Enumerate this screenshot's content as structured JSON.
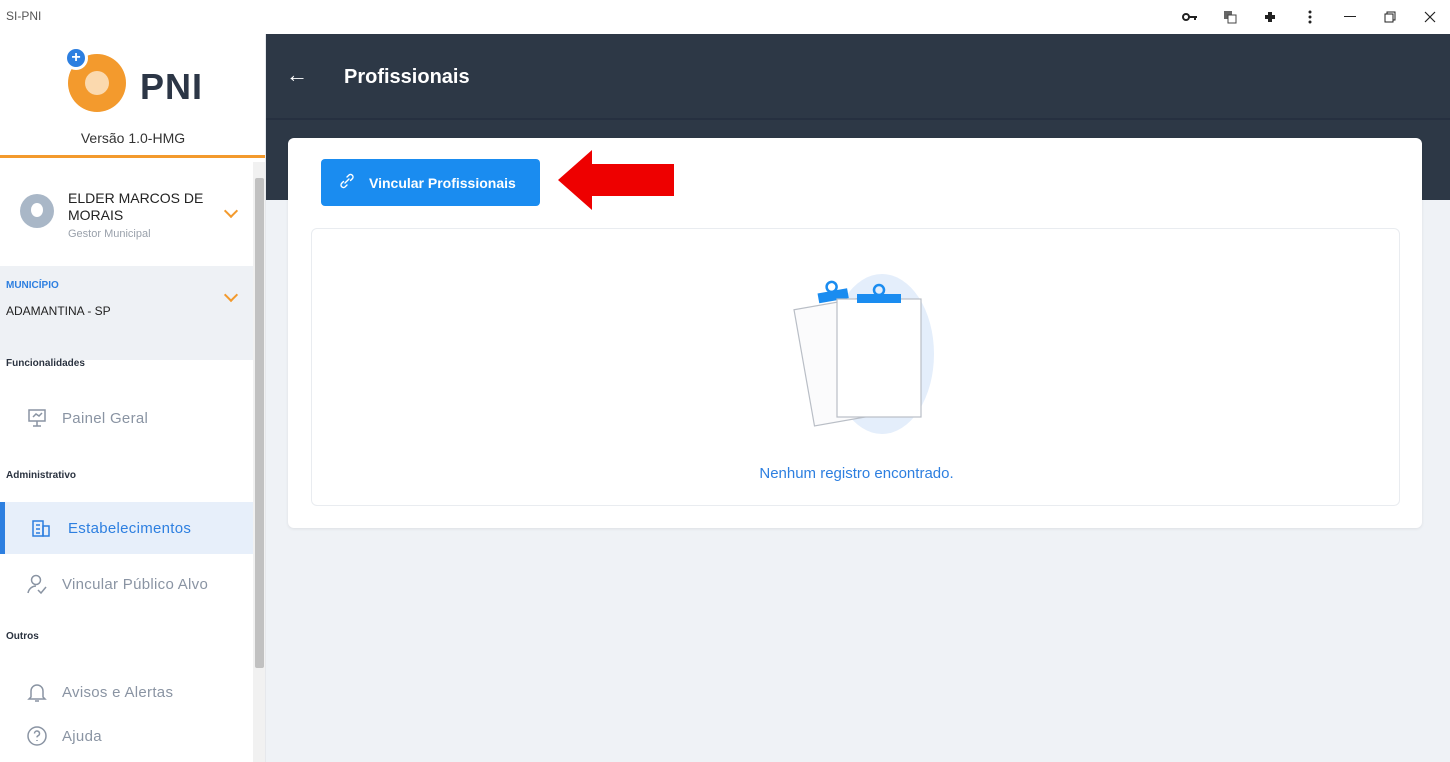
{
  "window": {
    "title": "SI-PNI",
    "controls": [
      "key-icon",
      "translate-icon",
      "extensions-icon",
      "menu-icon",
      "minimize-icon",
      "restore-icon",
      "close-icon"
    ]
  },
  "brand": {
    "name": "PNI",
    "version": "Versão 1.0-HMG"
  },
  "user": {
    "name": "ELDER MARCOS DE MORAIS",
    "role": "Gestor Municipal"
  },
  "municipio": {
    "label": "MUNICÍPIO",
    "value": "ADAMANTINA - SP"
  },
  "nav": {
    "sections": [
      "Funcionalidades",
      "Administrativo",
      "Outros"
    ],
    "items": [
      {
        "label": "Painel Geral",
        "icon": "presentation-icon"
      },
      {
        "label": "Estabelecimentos",
        "icon": "building-icon",
        "active": true
      },
      {
        "label": "Vincular Público Alvo",
        "icon": "user-check-icon"
      },
      {
        "label": "Avisos e Alertas",
        "icon": "bell-icon"
      },
      {
        "label": "Ajuda",
        "icon": "help-icon"
      }
    ]
  },
  "header": {
    "title": "Profissionais"
  },
  "actions": {
    "link_button": "Vincular Profissionais"
  },
  "empty": {
    "message": "Nenhum registro encontrado."
  },
  "colors": {
    "accent": "#1a8cf0",
    "header_bg": "#2d3846",
    "brand_orange": "#f39a2d",
    "annotation_arrow": "#ee0000"
  }
}
